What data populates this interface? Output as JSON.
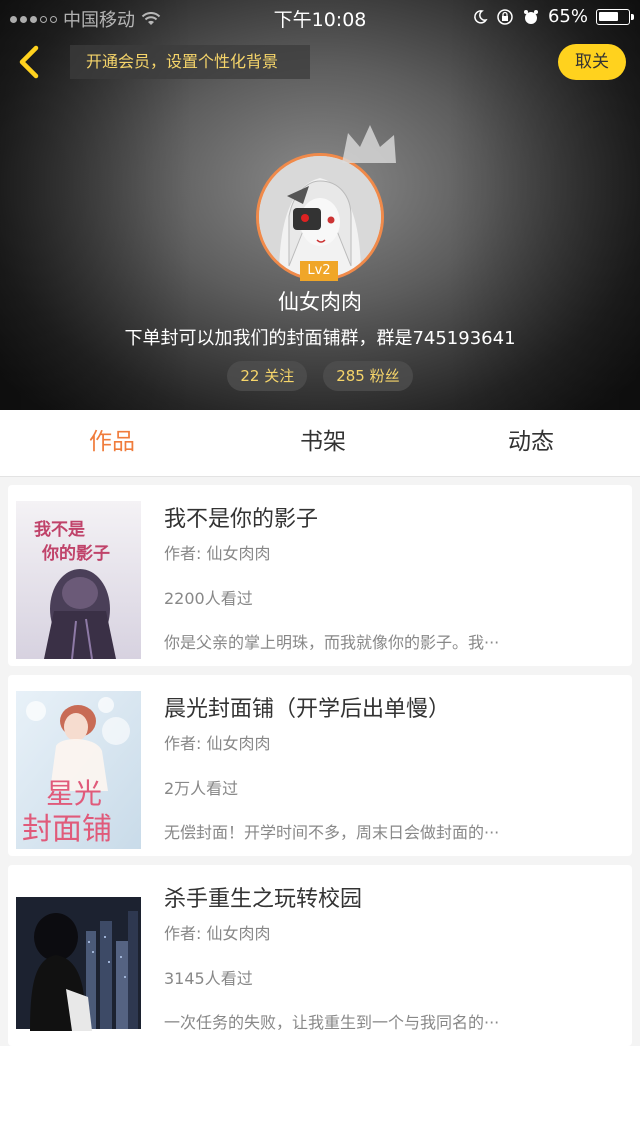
{
  "status_bar": {
    "carrier": "中国移动",
    "time": "下午10:08",
    "battery": "65%"
  },
  "header": {
    "vip_tip": "开通会员，设置个性化背景",
    "unfollow_label": "取关",
    "level": "Lv2",
    "nickname": "仙女肉肉",
    "bio": "下单封可以加我们的封面铺群，群是745193641",
    "following": "22 关注",
    "fans": "285 粉丝"
  },
  "tabs": [
    {
      "label": "作品",
      "active": true
    },
    {
      "label": "书架",
      "active": false
    },
    {
      "label": "动态",
      "active": false
    }
  ],
  "works": [
    {
      "title": "我不是你的影子",
      "author": "作者: 仙女肉肉",
      "views": "2200人看过",
      "desc": "你是父亲的掌上明珠，而我就像你的影子。我···",
      "cover_text": "我不是你的影子"
    },
    {
      "title": "晨光封面铺（开学后出单慢）",
      "author": "作者: 仙女肉肉",
      "views": "2万人看过",
      "desc": "无偿封面！开学时间不多，周末日会做封面的···",
      "cover_text": "星光封面铺"
    },
    {
      "title": "杀手重生之玩转校园",
      "author": "作者: 仙女肉肉",
      "views": "3145人看过",
      "desc": "一次任务的失败，让我重生到一个与我同名的···",
      "cover_text": ""
    }
  ],
  "colors": {
    "accent": "#f07c3c",
    "vip_text": "#f6d56a",
    "unfollow_bg": "#ffd21e"
  }
}
